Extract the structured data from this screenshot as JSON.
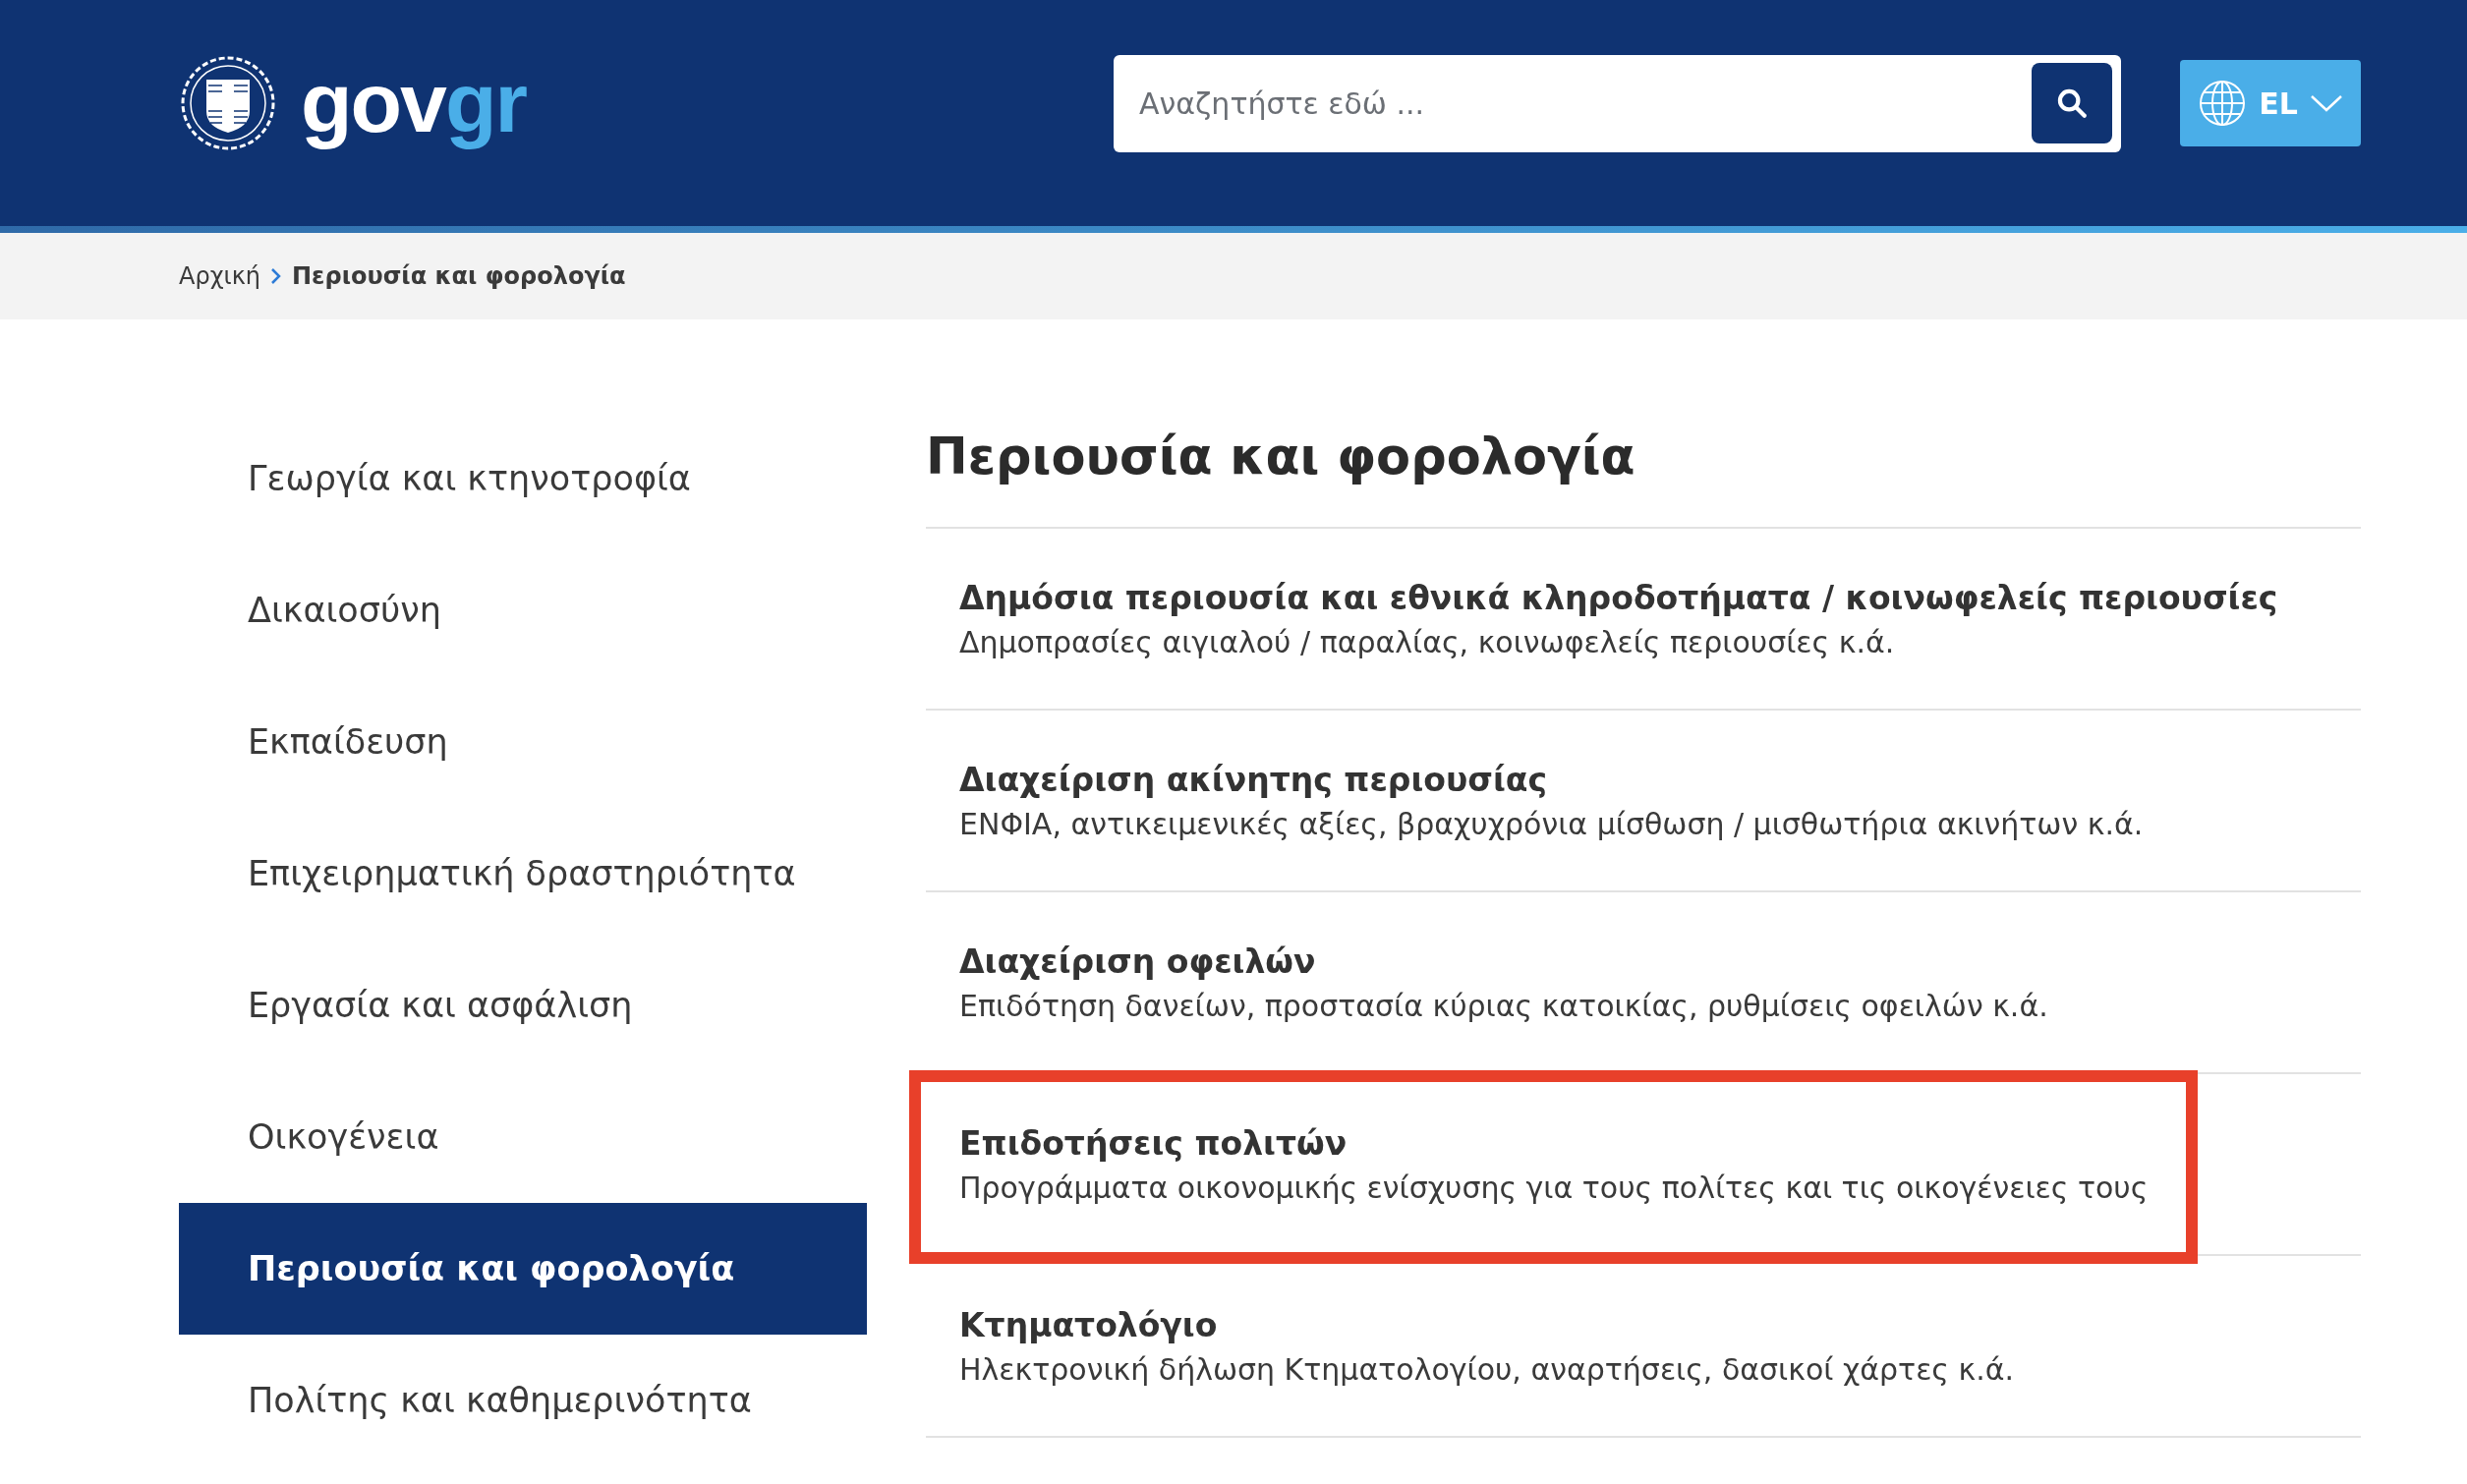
{
  "header": {
    "logo": {
      "part_1": "gov",
      "part_2": "gr"
    },
    "search": {
      "placeholder": "Αναζητήστε εδώ ..."
    },
    "language": "EL"
  },
  "breadcrumb": [
    {
      "label": "Αρχική",
      "current": false
    },
    {
      "label": "Περιουσία και φορολογία",
      "current": true
    }
  ],
  "sidebar": {
    "items": [
      {
        "label": "Γεωργία και κτηνοτροφία",
        "selected": false
      },
      {
        "label": "Δικαιοσύνη",
        "selected": false
      },
      {
        "label": "Εκπαίδευση",
        "selected": false
      },
      {
        "label": "Επιχειρηματική δραστηριότητα",
        "selected": false
      },
      {
        "label": "Εργασία και ασφάλιση",
        "selected": false
      },
      {
        "label": "Οικογένεια",
        "selected": false
      },
      {
        "label": "Περιουσία και φορολογία",
        "selected": true
      },
      {
        "label": "Πολίτης και καθημερινότητα",
        "selected": false
      }
    ]
  },
  "content": {
    "title": "Περιουσία και φορολογία",
    "items": [
      {
        "title": "Δημόσια περιουσία και εθνικά κληροδοτήματα / κοινωφελείς περιουσίες",
        "description": "Δημοπρασίες αιγιαλού / παραλίας, κοινωφελείς περιουσίες κ.ά.",
        "highlighted": false
      },
      {
        "title": "Διαχείριση ακίνητης περιουσίας",
        "description": "ΕΝΦΙΑ, αντικειμενικές αξίες, βραχυχρόνια μίσθωση / μισθωτήρια ακινήτων κ.ά.",
        "highlighted": false
      },
      {
        "title": "Διαχείριση οφειλών",
        "description": "Επιδότηση δανείων, προστασία κύριας κατοικίας, ρυθμίσεις οφειλών κ.ά.",
        "highlighted": false
      },
      {
        "title": "Επιδοτήσεις πολιτών",
        "description": "Προγράμματα οικονομικής ενίσχυσης για τους πολίτες και τις οικογένειες τους",
        "highlighted": true
      },
      {
        "title": "Κτηματολόγιο",
        "description": "Ηλεκτρονική δήλωση Κτηματολογίου, αναρτήσεις, δασικοί χάρτες κ.ά.",
        "highlighted": false
      }
    ]
  }
}
